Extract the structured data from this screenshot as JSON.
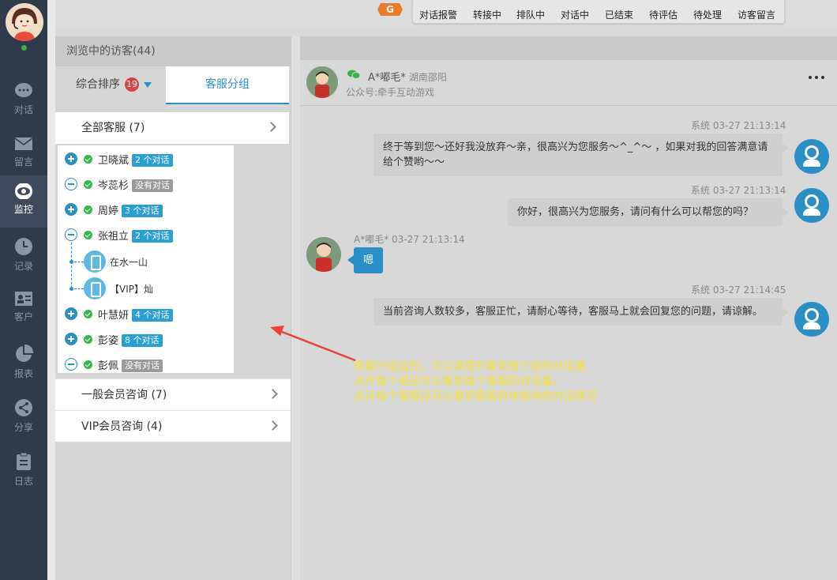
{
  "nav": {
    "items": [
      {
        "label": "对话",
        "icon": "chat-bubble-icon"
      },
      {
        "label": "留言",
        "icon": "mail-icon"
      },
      {
        "label": "监控",
        "icon": "eye-icon"
      },
      {
        "label": "记录",
        "icon": "clock-icon"
      },
      {
        "label": "客户",
        "icon": "contact-card-icon"
      },
      {
        "label": "报表",
        "icon": "pie-chart-icon"
      },
      {
        "label": "分享",
        "icon": "share-icon"
      },
      {
        "label": "日志",
        "icon": "clipboard-icon"
      }
    ],
    "active": "监控"
  },
  "toolbar": {
    "items": [
      "对话报警",
      "转接中",
      "排队中",
      "对话中",
      "已结束",
      "待评估",
      "待处理",
      "访客留言"
    ]
  },
  "left_panel": {
    "title": "浏览中的访客(44)",
    "sort_tab": "综合排序",
    "sort_badge": "19",
    "group_tab": "客服分组",
    "all_group": "全部客服 (7)",
    "agents": [
      {
        "name": "卫晓斌",
        "badge": "2 个对话",
        "expanded": false
      },
      {
        "name": "岑蕊杉",
        "badge": "没有对话",
        "expanded": true
      },
      {
        "name": "周婷",
        "badge": "3 个对话",
        "expanded": false
      },
      {
        "name": "张祖立",
        "badge": "2 个对话",
        "expanded": true
      },
      {
        "name": "叶慧妍",
        "badge": "4 个对话",
        "expanded": false
      },
      {
        "name": "彭姿",
        "badge": "8 个对话",
        "expanded": false
      },
      {
        "name": "彭佩",
        "badge": "没有对话",
        "expanded": true
      }
    ],
    "sub_visitors": [
      "在水一山",
      "【VIP】灿"
    ],
    "groups": [
      "一般会员咨询 (7)",
      "VIP会员咨询 (4)"
    ]
  },
  "chat": {
    "visitor_name": "A*嘟毛*",
    "visitor_location": "湖南邵阳",
    "visitor_source": "公众号:牵手互动游戏",
    "messages": [
      {
        "from": "系统",
        "time": "03-27 21:13:14",
        "text": "终于等到您～还好我没放弃～亲，很高兴为您服务～^_^～ ，如果对我的回答满意请给个赞哟～～"
      },
      {
        "from": "系统",
        "time": "03-27 21:13:14",
        "text": "你好，很高兴为您服务，请问有什么可以帮您的吗？"
      },
      {
        "from": "A*嘟毛*",
        "time": "03-27 21:13:14",
        "text": "嗯"
      },
      {
        "from": "系统",
        "time": "03-27 21:14:45",
        "text": "当前咨询人数较多，客服正忙，请耐心等待，客服马上就会回复您的问题，请谅解。"
      }
    ]
  },
  "annotation": {
    "lines": [
      "根据分组监控，可以清楚的看到每个组的对话量",
      "点开每个组还可以看到每个客服的对话量，",
      "点开每个客服还可以看到客服具体接待的对话情况"
    ]
  },
  "colors": {
    "accent": "#2a8fc7",
    "nav_bg": "#2f3b4a",
    "annotation": "#f7e13a",
    "online": "#36b54a"
  }
}
